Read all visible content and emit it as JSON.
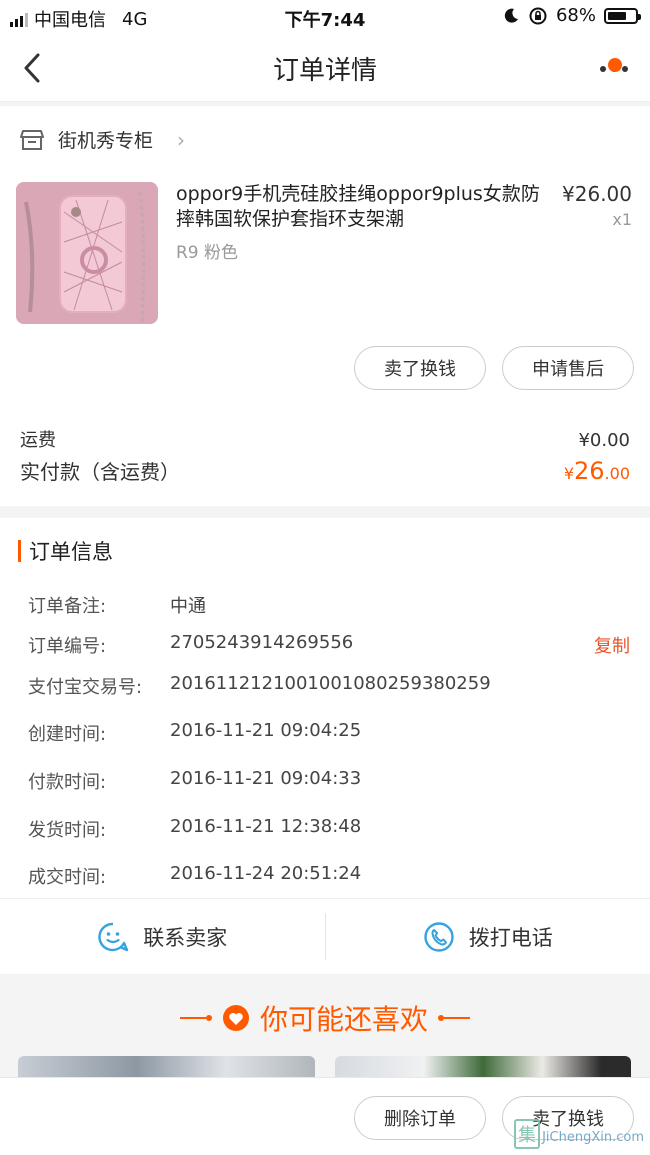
{
  "status_bar": {
    "carrier": "中国电信",
    "network": "4G",
    "time": "下午7:44",
    "battery_percent": "68%",
    "battery_level": 0.68
  },
  "nav": {
    "title": "订单详情"
  },
  "store": {
    "name": "街机秀专柜"
  },
  "product": {
    "title": "oppor9手机壳硅胶挂绳oppor9plus女款防摔韩国软保护套指环支架潮",
    "sku": "R9 粉色",
    "price": "¥26.00",
    "qty": "x1"
  },
  "item_actions": {
    "sell_label": "卖了换钱",
    "aftersale_label": "申请售后"
  },
  "fees": {
    "shipping_label": "运费",
    "shipping_value": "¥0.00",
    "total_label": "实付款（含运费）",
    "total_currency": "¥",
    "total_int": "26",
    "total_dec": ".00"
  },
  "order_info": {
    "title": "订单信息",
    "copy_label": "复制",
    "rows": [
      {
        "label": "订单备注:",
        "value": "中通"
      },
      {
        "label": "订单编号:",
        "value": "2705243914269556"
      },
      {
        "label": "支付宝交易号:",
        "value": "2016112121001001080259380259"
      },
      {
        "label": "创建时间:",
        "value": "2016-11-21 09:04:25"
      },
      {
        "label": "付款时间:",
        "value": "2016-11-21 09:04:33"
      },
      {
        "label": "发货时间:",
        "value": "2016-11-21 12:38:48"
      },
      {
        "label": "成交时间:",
        "value": "2016-11-24 20:51:24"
      }
    ]
  },
  "contact": {
    "seller_label": "联系卖家",
    "phone_label": "拨打电话"
  },
  "recommend": {
    "title": "你可能还喜欢"
  },
  "bottom": {
    "delete_label": "删除订单",
    "sell_label": "卖了换钱"
  },
  "watermark": {
    "badge": "集",
    "text": "JiChengXin.com"
  },
  "colors": {
    "accent": "#ff5a00",
    "copy_link": "#e8542a",
    "contact_icon": "#35a3e0"
  }
}
